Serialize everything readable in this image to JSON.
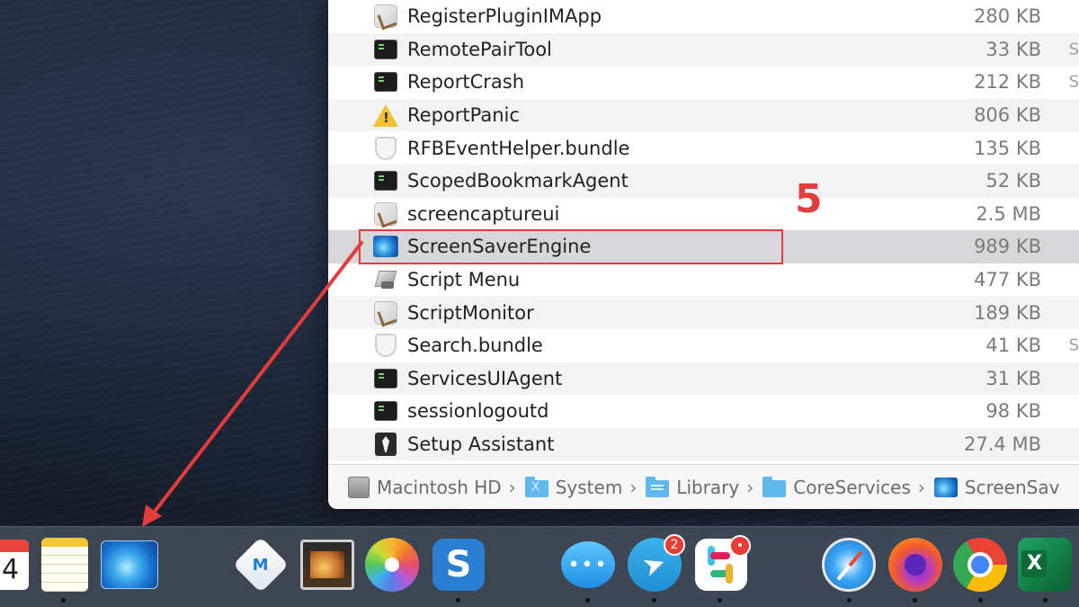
{
  "finder": {
    "files": [
      {
        "name": "RegisterPluginIMApp",
        "size": "280 KB",
        "icon": "app-generic-icon"
      },
      {
        "name": "RemotePairTool",
        "size": "33 KB",
        "icon": "terminal-icon"
      },
      {
        "name": "ReportCrash",
        "size": "212 KB",
        "icon": "terminal-icon"
      },
      {
        "name": "ReportPanic",
        "size": "806 KB",
        "icon": "warning-icon"
      },
      {
        "name": "RFBEventHelper.bundle",
        "size": "135 KB",
        "icon": "bundle-icon"
      },
      {
        "name": "ScopedBookmarkAgent",
        "size": "52 KB",
        "icon": "terminal-icon"
      },
      {
        "name": "screencaptureui",
        "size": "2.5 MB",
        "icon": "app-generic-icon"
      },
      {
        "name": "ScreenSaverEngine",
        "size": "989 KB",
        "icon": "screensaver-icon"
      },
      {
        "name": "Script Menu",
        "size": "477 KB",
        "icon": "script-menu-icon"
      },
      {
        "name": "ScriptMonitor",
        "size": "189 KB",
        "icon": "app-generic-icon"
      },
      {
        "name": "Search.bundle",
        "size": "41 KB",
        "icon": "bundle-icon"
      },
      {
        "name": "ServicesUIAgent",
        "size": "31 KB",
        "icon": "terminal-icon"
      },
      {
        "name": "sessionlogoutd",
        "size": "98 KB",
        "icon": "terminal-icon"
      },
      {
        "name": "Setup Assistant",
        "size": "27.4 MB",
        "icon": "setup-assistant-icon"
      }
    ],
    "selected_index": 7,
    "edge_marks": [
      "",
      "S",
      "S",
      "",
      "",
      "",
      "",
      "",
      "",
      "",
      "S",
      "",
      "",
      ""
    ],
    "path": [
      "Macintosh HD",
      "System",
      "Library",
      "CoreServices",
      "ScreenSav"
    ],
    "path_separator": "›"
  },
  "annotation": {
    "step_label": "5",
    "color": "#e23c3c"
  },
  "dock": {
    "calendar_day": "4",
    "finder_logo_letter": "M",
    "snagit_letter": "S",
    "telegram_badge": "2",
    "slack_badge": "•",
    "excel_letter": "X",
    "messages_dots": "•••",
    "telegram_glyph": "➤",
    "apps": [
      "calendar-icon",
      "notes-icon",
      "screensaver-icon",
      "m-app-icon",
      "preview-icon",
      "photos-icon",
      "snagit-icon",
      "messages-icon",
      "telegram-icon",
      "slack-icon",
      "safari-icon",
      "firefox-icon",
      "chrome-icon",
      "excel-icon"
    ]
  }
}
